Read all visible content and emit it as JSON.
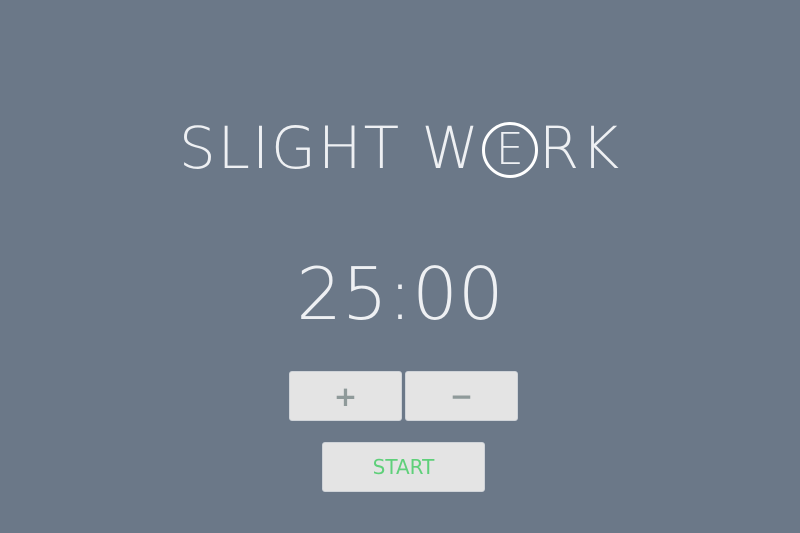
{
  "logo": {
    "before": "SLIGHT W",
    "ring_letter": "E",
    "after": "RK"
  },
  "timer": {
    "display": "25:00"
  },
  "controls": {
    "increment_label": "+",
    "decrement_label": "−",
    "start_label": "START"
  },
  "colors": {
    "background": "#6b7888",
    "button": "#e4e4e4",
    "start_text": "#5fd07a",
    "stepper_text": "#8f9a9a"
  }
}
